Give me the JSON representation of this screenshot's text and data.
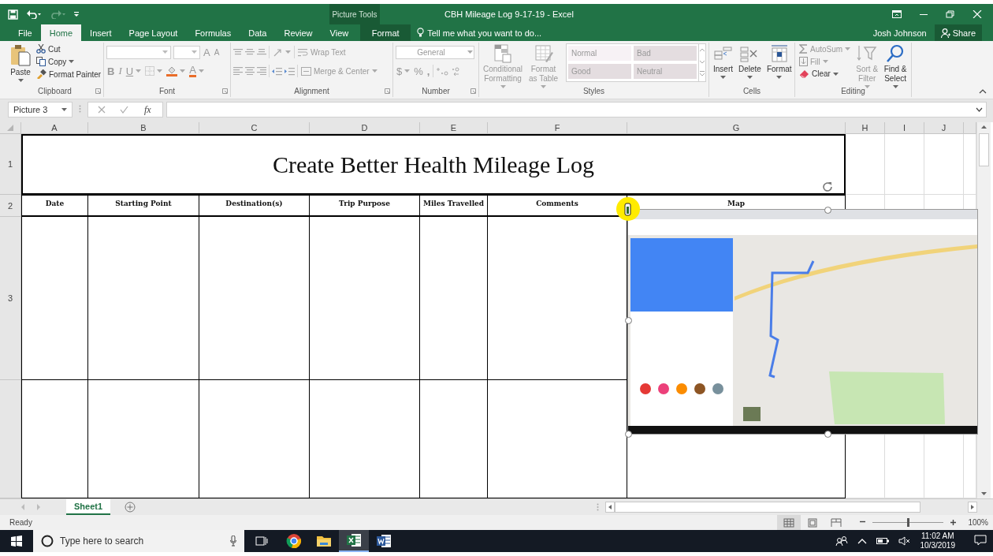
{
  "window": {
    "context_label": "Picture Tools",
    "title": "CBH Mileage Log 9-17-19 - Excel"
  },
  "tabs": [
    {
      "label": "File",
      "selected": false,
      "kind": "standard"
    },
    {
      "label": "Home",
      "selected": true,
      "kind": "standard"
    },
    {
      "label": "Insert",
      "selected": false,
      "kind": "standard"
    },
    {
      "label": "Page Layout",
      "selected": false,
      "kind": "standard"
    },
    {
      "label": "Formulas",
      "selected": false,
      "kind": "standard"
    },
    {
      "label": "Data",
      "selected": false,
      "kind": "standard"
    },
    {
      "label": "Review",
      "selected": false,
      "kind": "standard"
    },
    {
      "label": "View",
      "selected": false,
      "kind": "standard"
    },
    {
      "label": "Format",
      "selected": false,
      "kind": "context"
    }
  ],
  "tell_me": {
    "placeholder": "Tell me what you want to do..."
  },
  "account": {
    "user": "Josh Johnson",
    "share": "Share"
  },
  "ribbon": {
    "groups": [
      {
        "kind": "clipboard",
        "label": "Clipboard",
        "launcher": true,
        "paste": "Paste",
        "cut": "Cut",
        "copy": "Copy",
        "format_painter": "Format Painter"
      },
      {
        "kind": "font",
        "label": "Font",
        "launcher": true,
        "grow": "A",
        "shrink": "A",
        "bold": "B",
        "italic": "I",
        "underline": "U",
        "font_color": "A"
      },
      {
        "kind": "alignment",
        "label": "Alignment",
        "launcher": true,
        "wrap_text": "Wrap Text",
        "merge": "Merge & Center"
      },
      {
        "kind": "number",
        "label": "Number",
        "launcher": true,
        "format": "General",
        "currency": "$",
        "percent": "%",
        "comma": ","
      },
      {
        "kind": "styles",
        "label": "Styles",
        "launcher": false,
        "conditional": "Conditional Formatting",
        "format_table": "Format as Table",
        "styles": [
          "Normal",
          "Bad",
          "Good",
          "Neutral"
        ]
      },
      {
        "kind": "cells",
        "label": "Cells",
        "launcher": false,
        "buttons": [
          "Insert",
          "Delete",
          "Format"
        ]
      },
      {
        "kind": "editing",
        "label": "Editing",
        "launcher": false,
        "autosum": "AutoSum",
        "fill": "Fill",
        "clear": "Clear",
        "sort": "Sort & Filter",
        "find": "Find & Select"
      }
    ]
  },
  "formula_bar": {
    "name_box": "Picture 3",
    "function": "fx"
  },
  "sheet": {
    "columns": [
      "A",
      "B",
      "C",
      "D",
      "E",
      "F",
      "G",
      "H",
      "I",
      "J"
    ],
    "rows": [
      "1",
      "2",
      "3"
    ],
    "title": "Create Better Health Mileage Log",
    "headers": [
      "Date",
      "Starting Point",
      "Destination(s)",
      "Trip Purpose",
      "Miles Travelled",
      "Comments",
      "Map"
    ],
    "picture": {
      "kind": "picture"
    }
  },
  "sheet_tabs": [
    {
      "label": "Sheet1",
      "selected": true
    }
  ],
  "status_bar": {
    "status": "Ready",
    "views": [
      {
        "kind": "normal",
        "selected": true
      },
      {
        "kind": "page_layout",
        "selected": false
      },
      {
        "kind": "page_break",
        "selected": false
      }
    ],
    "zoom": {
      "level": 0.5,
      "reading": "100%"
    }
  },
  "taskbar": {
    "search": {
      "placeholder": "Type here to search"
    },
    "apps": [
      {
        "kind": "browser",
        "selected": false
      },
      {
        "kind": "folder",
        "selected": false
      },
      {
        "kind": "spreadsheet",
        "selected": true
      },
      {
        "kind": "document",
        "selected": false
      }
    ],
    "time": "11:02 AM",
    "date": "10/3/2019"
  }
}
